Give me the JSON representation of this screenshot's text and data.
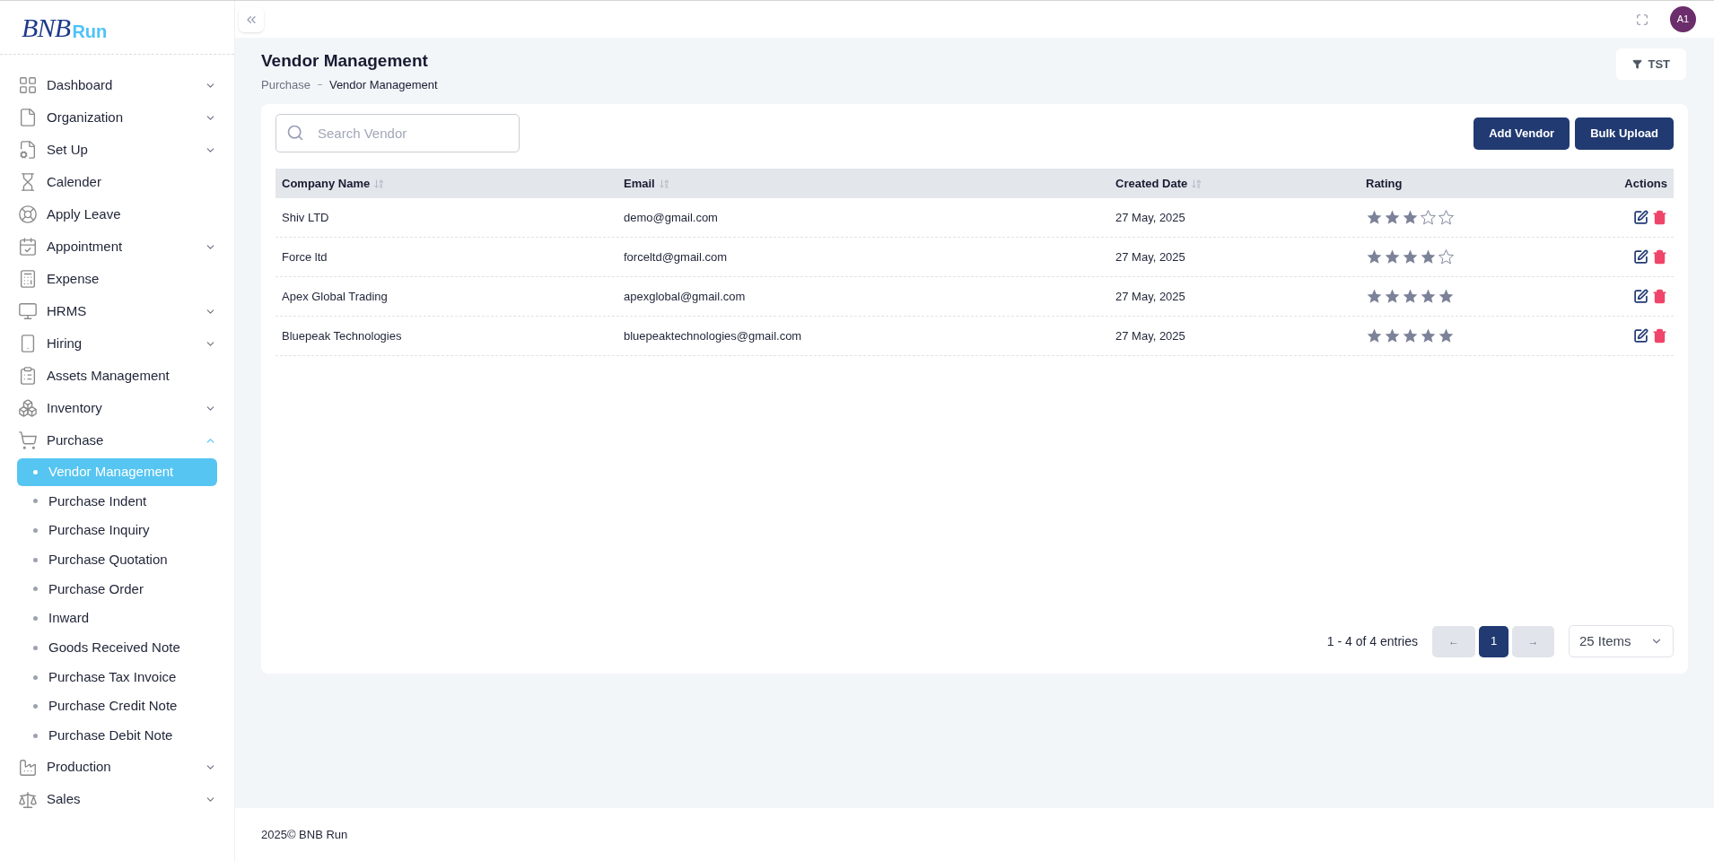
{
  "brand": {
    "mark": "BNB",
    "name": "Run"
  },
  "sidebar": {
    "items": [
      {
        "label": "Dashboard",
        "kind": "group",
        "expanded": false
      },
      {
        "label": "Organization",
        "kind": "group",
        "expanded": false
      },
      {
        "label": "Set Up",
        "kind": "group",
        "expanded": false
      },
      {
        "label": "Calender",
        "kind": "link"
      },
      {
        "label": "Apply Leave",
        "kind": "link"
      },
      {
        "label": "Appointment",
        "kind": "group",
        "expanded": false
      },
      {
        "label": "Expense",
        "kind": "link"
      },
      {
        "label": "HRMS",
        "kind": "group",
        "expanded": false
      },
      {
        "label": "Hiring",
        "kind": "group",
        "expanded": false
      },
      {
        "label": "Assets Management",
        "kind": "link"
      },
      {
        "label": "Inventory",
        "kind": "group",
        "expanded": false
      },
      {
        "label": "Purchase",
        "kind": "group",
        "expanded": true,
        "children": [
          {
            "label": "Vendor Management",
            "selected": true
          },
          {
            "label": "Purchase Indent",
            "selected": false
          },
          {
            "label": "Purchase Inquiry",
            "selected": false
          },
          {
            "label": "Purchase Quotation",
            "selected": false
          },
          {
            "label": "Purchase Order",
            "selected": false
          },
          {
            "label": "Inward",
            "selected": false
          },
          {
            "label": "Goods Received Note",
            "selected": false
          },
          {
            "label": "Purchase Tax Invoice",
            "selected": false
          },
          {
            "label": "Purchase Credit Note",
            "selected": false
          },
          {
            "label": "Purchase Debit Note",
            "selected": false
          }
        ]
      },
      {
        "label": "Production",
        "kind": "group",
        "expanded": false
      },
      {
        "label": "Sales",
        "kind": "group",
        "expanded": false
      }
    ]
  },
  "topbar": {
    "avatar": "A1"
  },
  "page": {
    "title": "Vendor Management",
    "breadcrumb": [
      "Purchase",
      "Vendor Management"
    ],
    "filter_button": "TST"
  },
  "search": {
    "placeholder": "Search Vendor"
  },
  "buttons": [
    "Add Vendor",
    "Bulk Upload"
  ],
  "table": {
    "columns": [
      {
        "label": "Company Name",
        "sortable": true
      },
      {
        "label": "Email",
        "sortable": true
      },
      {
        "label": "Created Date",
        "sortable": true
      },
      {
        "label": "Rating",
        "sortable": false
      },
      {
        "label": "Actions",
        "sortable": false
      }
    ],
    "rows": [
      {
        "company": "Shiv LTD",
        "email": "demo@gmail.com",
        "created": "27 May, 2025",
        "stars": 3
      },
      {
        "company": "Force ltd",
        "email": "forceltd@gmail.com",
        "created": "27 May, 2025",
        "stars": 4
      },
      {
        "company": "Apex Global Trading",
        "email": "apexglobal@gmail.com",
        "created": "27 May, 2025",
        "stars": 5
      },
      {
        "company": "Bluepeak Technologies",
        "email": "bluepeaktechnologies@gmail.com",
        "created": "27 May, 2025",
        "stars": 5
      }
    ]
  },
  "pagination": {
    "summary": "1 - 4 of 4 entries",
    "prev": "←",
    "pages": [
      {
        "label": "1",
        "selected": true
      }
    ],
    "next": "→",
    "page_size": "25 Items"
  },
  "footer": "2025© BNB Run"
}
